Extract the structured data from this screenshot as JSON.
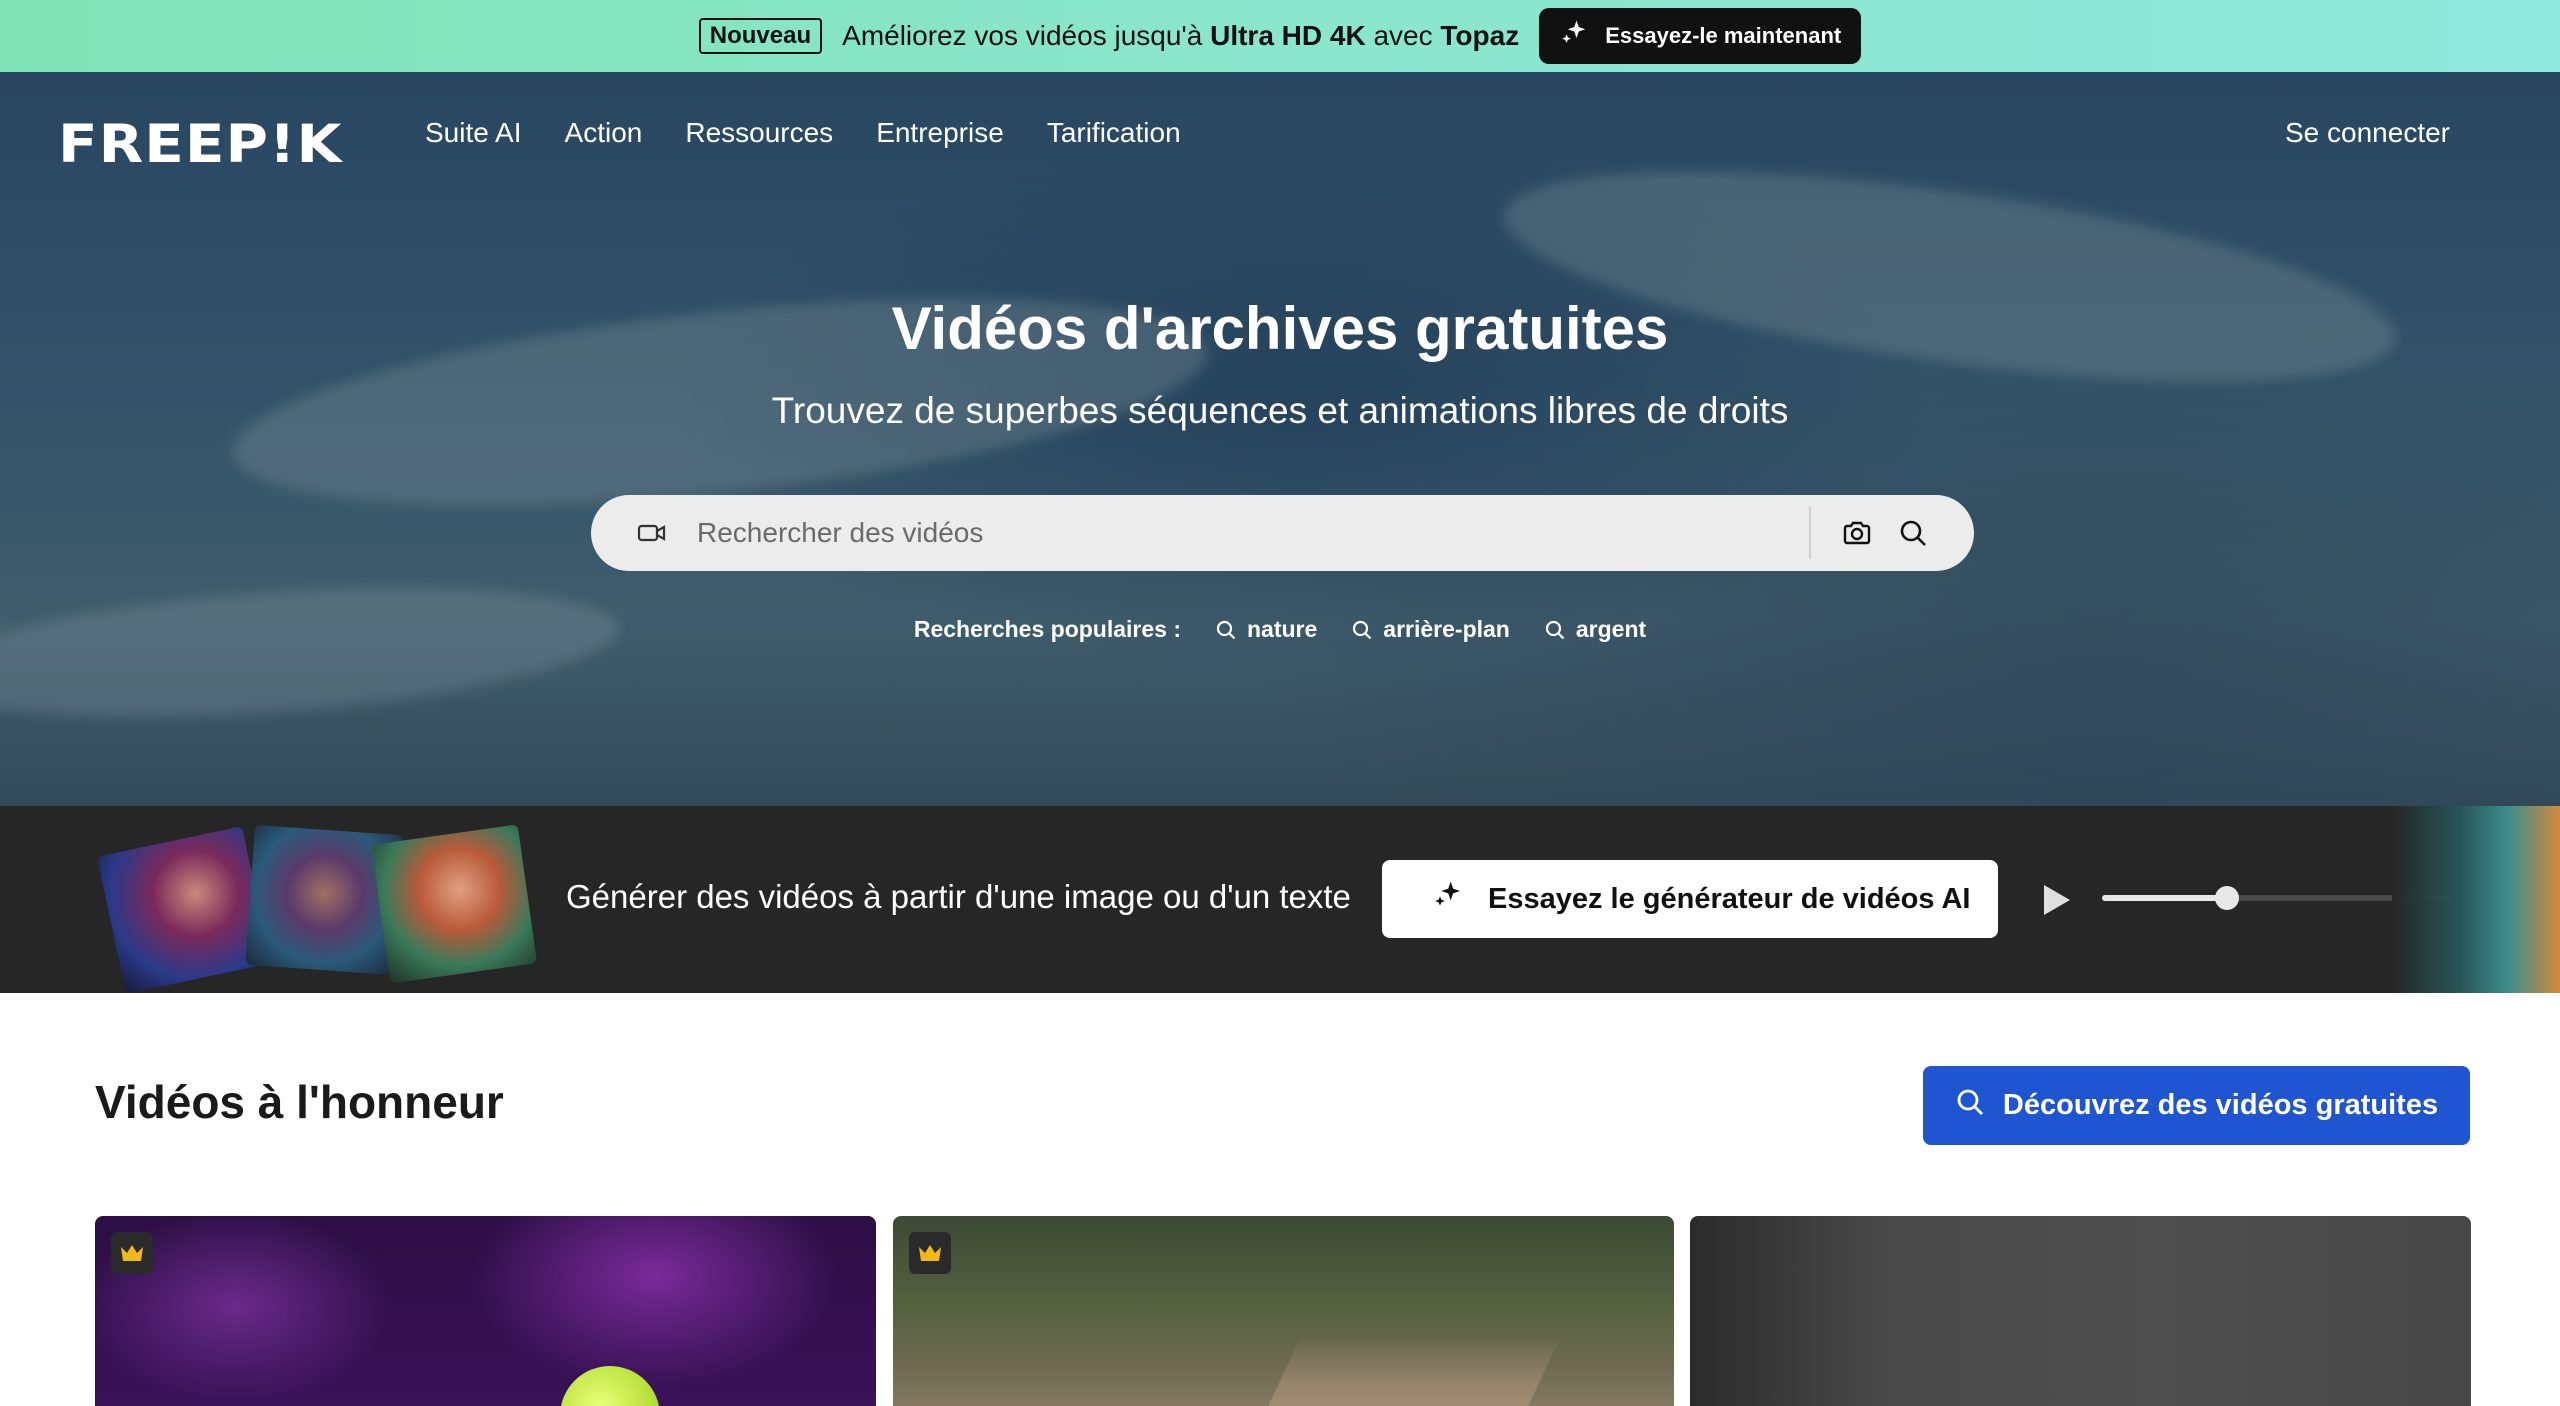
{
  "promo": {
    "badge": "Nouveau",
    "text_prefix": "Améliorez vos vidéos jusqu'à ",
    "text_highlight": "Ultra HD 4K",
    "text_mid": " avec ",
    "text_brand": "Topaz",
    "cta": "Essayez-le maintenant",
    "cta_icon": "sparkles-icon",
    "background": "#8ae6cc"
  },
  "header": {
    "logo": "FREEP!K",
    "nav": [
      "Suite AI",
      "Action",
      "Ressources",
      "Entreprise",
      "Tarification"
    ],
    "signin": "Se connecter"
  },
  "hero": {
    "title": "Vidéos d'archives gratuites",
    "subtitle": "Trouvez de superbes séquences et animations libres de droits",
    "search": {
      "placeholder": "Rechercher des vidéos",
      "value": "",
      "left_icon": "video-camera-icon",
      "icons": [
        "camera-icon",
        "search-icon"
      ]
    },
    "popular_label": "Recherches populaires :",
    "popular": [
      "nature",
      "arrière-plan",
      "argent"
    ]
  },
  "ai_strip": {
    "text": "Générer des vidéos à partir d'une image ou d'un texte",
    "cta": "Essayez le générateur de vidéos AI",
    "cta_icon": "sparkles-icon",
    "player": {
      "play_icon": "play-icon",
      "progress": 0.36
    }
  },
  "featured": {
    "title": "Vidéos à l'honneur",
    "cta": "Découvrez des vidéos gratuites",
    "cta_icon": "search-icon",
    "accent": "#1f55d1",
    "cards": [
      {
        "premium": true,
        "badge_icon": "crown-icon"
      },
      {
        "premium": true,
        "badge_icon": "crown-icon"
      },
      {
        "premium": false
      }
    ]
  }
}
